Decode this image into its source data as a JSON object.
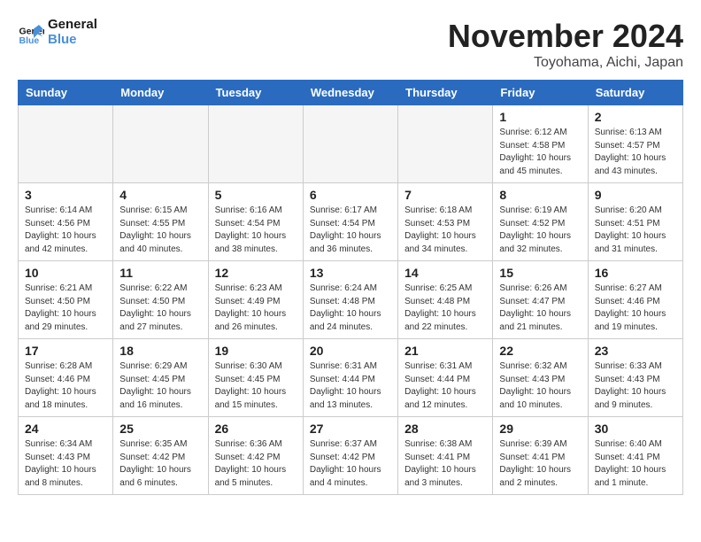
{
  "header": {
    "logo_line1": "General",
    "logo_line2": "Blue",
    "month_year": "November 2024",
    "location": "Toyohama, Aichi, Japan"
  },
  "weekdays": [
    "Sunday",
    "Monday",
    "Tuesday",
    "Wednesday",
    "Thursday",
    "Friday",
    "Saturday"
  ],
  "weeks": [
    [
      {
        "day": "",
        "info": ""
      },
      {
        "day": "",
        "info": ""
      },
      {
        "day": "",
        "info": ""
      },
      {
        "day": "",
        "info": ""
      },
      {
        "day": "",
        "info": ""
      },
      {
        "day": "1",
        "info": "Sunrise: 6:12 AM\nSunset: 4:58 PM\nDaylight: 10 hours\nand 45 minutes."
      },
      {
        "day": "2",
        "info": "Sunrise: 6:13 AM\nSunset: 4:57 PM\nDaylight: 10 hours\nand 43 minutes."
      }
    ],
    [
      {
        "day": "3",
        "info": "Sunrise: 6:14 AM\nSunset: 4:56 PM\nDaylight: 10 hours\nand 42 minutes."
      },
      {
        "day": "4",
        "info": "Sunrise: 6:15 AM\nSunset: 4:55 PM\nDaylight: 10 hours\nand 40 minutes."
      },
      {
        "day": "5",
        "info": "Sunrise: 6:16 AM\nSunset: 4:54 PM\nDaylight: 10 hours\nand 38 minutes."
      },
      {
        "day": "6",
        "info": "Sunrise: 6:17 AM\nSunset: 4:54 PM\nDaylight: 10 hours\nand 36 minutes."
      },
      {
        "day": "7",
        "info": "Sunrise: 6:18 AM\nSunset: 4:53 PM\nDaylight: 10 hours\nand 34 minutes."
      },
      {
        "day": "8",
        "info": "Sunrise: 6:19 AM\nSunset: 4:52 PM\nDaylight: 10 hours\nand 32 minutes."
      },
      {
        "day": "9",
        "info": "Sunrise: 6:20 AM\nSunset: 4:51 PM\nDaylight: 10 hours\nand 31 minutes."
      }
    ],
    [
      {
        "day": "10",
        "info": "Sunrise: 6:21 AM\nSunset: 4:50 PM\nDaylight: 10 hours\nand 29 minutes."
      },
      {
        "day": "11",
        "info": "Sunrise: 6:22 AM\nSunset: 4:50 PM\nDaylight: 10 hours\nand 27 minutes."
      },
      {
        "day": "12",
        "info": "Sunrise: 6:23 AM\nSunset: 4:49 PM\nDaylight: 10 hours\nand 26 minutes."
      },
      {
        "day": "13",
        "info": "Sunrise: 6:24 AM\nSunset: 4:48 PM\nDaylight: 10 hours\nand 24 minutes."
      },
      {
        "day": "14",
        "info": "Sunrise: 6:25 AM\nSunset: 4:48 PM\nDaylight: 10 hours\nand 22 minutes."
      },
      {
        "day": "15",
        "info": "Sunrise: 6:26 AM\nSunset: 4:47 PM\nDaylight: 10 hours\nand 21 minutes."
      },
      {
        "day": "16",
        "info": "Sunrise: 6:27 AM\nSunset: 4:46 PM\nDaylight: 10 hours\nand 19 minutes."
      }
    ],
    [
      {
        "day": "17",
        "info": "Sunrise: 6:28 AM\nSunset: 4:46 PM\nDaylight: 10 hours\nand 18 minutes."
      },
      {
        "day": "18",
        "info": "Sunrise: 6:29 AM\nSunset: 4:45 PM\nDaylight: 10 hours\nand 16 minutes."
      },
      {
        "day": "19",
        "info": "Sunrise: 6:30 AM\nSunset: 4:45 PM\nDaylight: 10 hours\nand 15 minutes."
      },
      {
        "day": "20",
        "info": "Sunrise: 6:31 AM\nSunset: 4:44 PM\nDaylight: 10 hours\nand 13 minutes."
      },
      {
        "day": "21",
        "info": "Sunrise: 6:31 AM\nSunset: 4:44 PM\nDaylight: 10 hours\nand 12 minutes."
      },
      {
        "day": "22",
        "info": "Sunrise: 6:32 AM\nSunset: 4:43 PM\nDaylight: 10 hours\nand 10 minutes."
      },
      {
        "day": "23",
        "info": "Sunrise: 6:33 AM\nSunset: 4:43 PM\nDaylight: 10 hours\nand 9 minutes."
      }
    ],
    [
      {
        "day": "24",
        "info": "Sunrise: 6:34 AM\nSunset: 4:43 PM\nDaylight: 10 hours\nand 8 minutes."
      },
      {
        "day": "25",
        "info": "Sunrise: 6:35 AM\nSunset: 4:42 PM\nDaylight: 10 hours\nand 6 minutes."
      },
      {
        "day": "26",
        "info": "Sunrise: 6:36 AM\nSunset: 4:42 PM\nDaylight: 10 hours\nand 5 minutes."
      },
      {
        "day": "27",
        "info": "Sunrise: 6:37 AM\nSunset: 4:42 PM\nDaylight: 10 hours\nand 4 minutes."
      },
      {
        "day": "28",
        "info": "Sunrise: 6:38 AM\nSunset: 4:41 PM\nDaylight: 10 hours\nand 3 minutes."
      },
      {
        "day": "29",
        "info": "Sunrise: 6:39 AM\nSunset: 4:41 PM\nDaylight: 10 hours\nand 2 minutes."
      },
      {
        "day": "30",
        "info": "Sunrise: 6:40 AM\nSunset: 4:41 PM\nDaylight: 10 hours\nand 1 minute."
      }
    ]
  ]
}
